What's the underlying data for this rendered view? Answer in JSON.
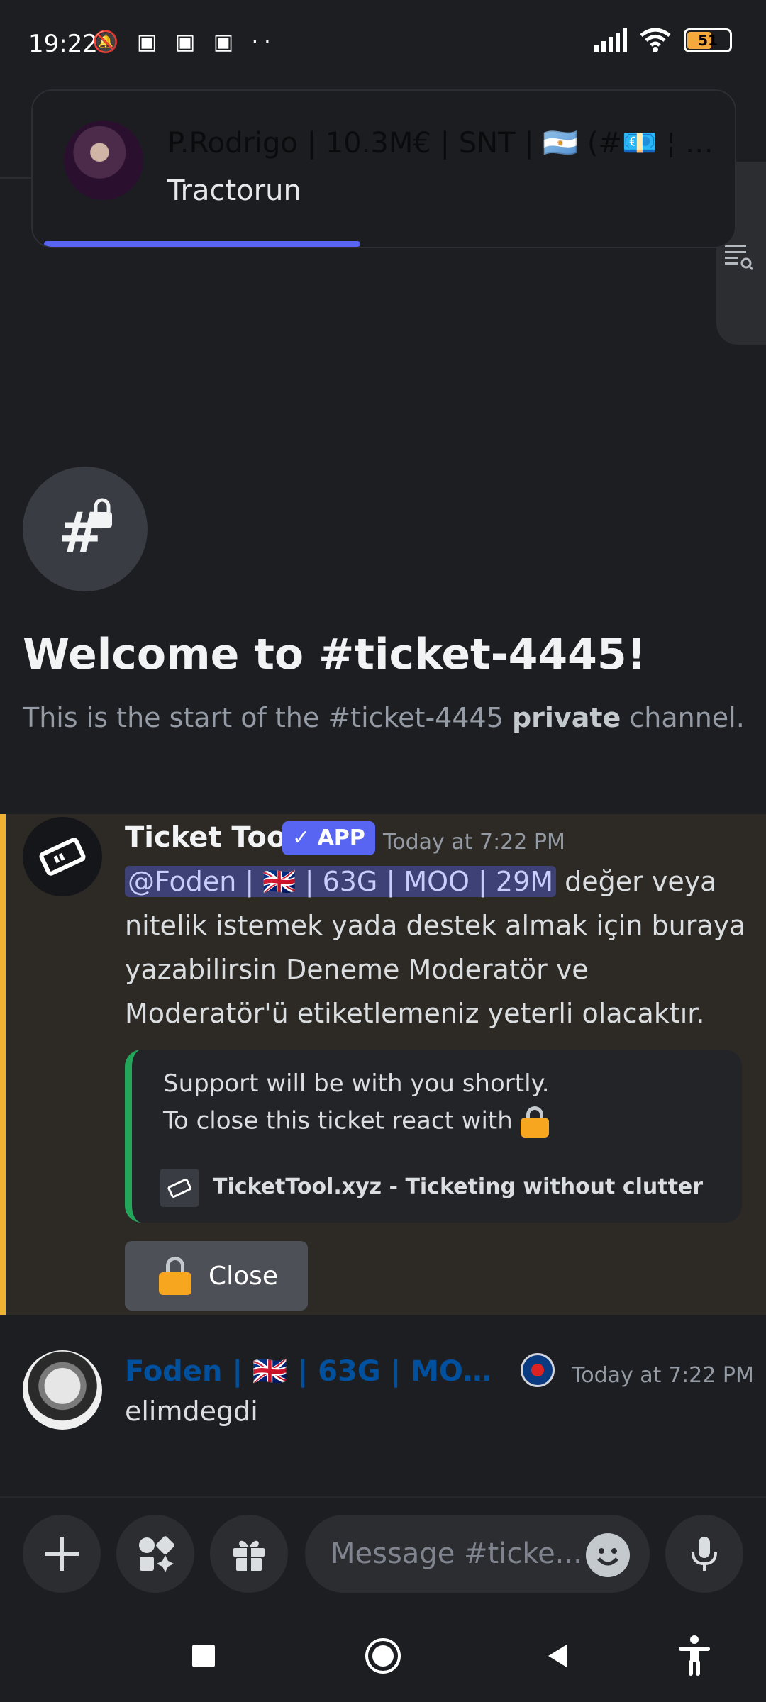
{
  "status_bar": {
    "time": "19:22",
    "left_icons": [
      "bell-muted",
      "discord",
      "discord",
      "discord",
      "more-dots"
    ],
    "battery_level": "51"
  },
  "notification": {
    "title": "P.Rodrigo | 10.3M€ | SNT | 🇦🇷 (#💶 ¦ t...",
    "message": "Tractorun"
  },
  "channel": {
    "welcome_title": "Welcome to #ticket-4445!",
    "welcome_sub_prefix": "This is the start of the #ticket-4445 ",
    "welcome_sub_bold": "private",
    "welcome_sub_suffix": " channel."
  },
  "messages": [
    {
      "author": "Ticket Tool",
      "badge": "✓ APP",
      "time": "Today at 7:22 PM",
      "mention": "@Foden | 🇬🇧 | 63G | MOO | 29M",
      "text": " değer veya nitelik istemek yada destek almak için buraya yazabilirsin Deneme Moderatör ve Moderatör'ü etiketlemeniz yeterli olacaktır.",
      "embed": {
        "line1": "Support will be with you shortly.",
        "line2": "To close this ticket react with",
        "footer": "TicketTool.xyz - Ticketing without clutter",
        "accent_color": "#23a55a"
      },
      "button_label": "Close"
    },
    {
      "author": "Foden | 🇬🇧 | 63G | MOO | 2...",
      "time": "Today at 7:22 PM",
      "text": "elimdegdi",
      "name_color": "#00509e"
    }
  ],
  "composer": {
    "placeholder": "Message #ticke..."
  },
  "colors": {
    "background": "#1d1e22",
    "highlight_border": "#f0b232",
    "brand": "#5865f2"
  }
}
